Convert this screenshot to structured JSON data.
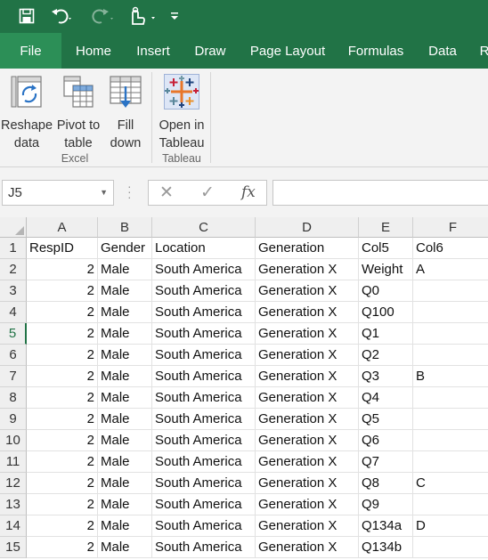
{
  "theme": {
    "brand": "#217346",
    "ribbon_bg": "#f3f3f3",
    "header_bg": "#efefef",
    "active_row_color": "#217346"
  },
  "quick_access": [
    {
      "name": "save-icon"
    },
    {
      "name": "undo-icon"
    },
    {
      "name": "redo-icon"
    },
    {
      "name": "touch-mode-icon"
    },
    {
      "name": "customize-quick-access-icon"
    }
  ],
  "tabs": [
    "File",
    "Home",
    "Insert",
    "Draw",
    "Page Layout",
    "Formulas",
    "Data",
    "R"
  ],
  "ribbon": {
    "buttons": [
      {
        "line1": "Reshape",
        "line2": "data",
        "icon": "reshape-data-icon"
      },
      {
        "line1": "Pivot to",
        "line2": "table",
        "icon": "pivot-table-icon"
      },
      {
        "line1": "Fill",
        "line2": "down",
        "icon": "fill-down-icon"
      },
      {
        "line1": "Open in",
        "line2": "Tableau",
        "icon": "tableau-icon"
      }
    ],
    "groups": [
      "Excel",
      "Tableau"
    ]
  },
  "formula_bar": {
    "name_box": "J5",
    "cancel_symbol": "✕",
    "enter_symbol": "✓",
    "fx_symbol": "fx",
    "formula": ""
  },
  "grid": {
    "active_row": "5",
    "columns": [
      "A",
      "B",
      "C",
      "D",
      "E",
      "F"
    ],
    "row_numbers": [
      "1",
      "2",
      "3",
      "4",
      "5",
      "6",
      "7",
      "8",
      "9",
      "10",
      "11",
      "12",
      "13",
      "14",
      "15"
    ],
    "rows": [
      [
        "RespID",
        "Gender",
        "Location",
        "Generation",
        "Col5",
        "Col6"
      ],
      [
        "2",
        "Male",
        "South America",
        "Generation X",
        "Weight",
        "A"
      ],
      [
        "2",
        "Male",
        "South America",
        "Generation X",
        "Q0",
        ""
      ],
      [
        "2",
        "Male",
        "South America",
        "Generation X",
        "Q100",
        ""
      ],
      [
        "2",
        "Male",
        "South America",
        "Generation X",
        "Q1",
        ""
      ],
      [
        "2",
        "Male",
        "South America",
        "Generation X",
        "Q2",
        ""
      ],
      [
        "2",
        "Male",
        "South America",
        "Generation X",
        "Q3",
        "B"
      ],
      [
        "2",
        "Male",
        "South America",
        "Generation X",
        "Q4",
        ""
      ],
      [
        "2",
        "Male",
        "South America",
        "Generation X",
        "Q5",
        ""
      ],
      [
        "2",
        "Male",
        "South America",
        "Generation X",
        "Q6",
        ""
      ],
      [
        "2",
        "Male",
        "South America",
        "Generation X",
        "Q7",
        ""
      ],
      [
        "2",
        "Male",
        "South America",
        "Generation X",
        "Q8",
        "C"
      ],
      [
        "2",
        "Male",
        "South America",
        "Generation X",
        "Q9",
        ""
      ],
      [
        "2",
        "Male",
        "South America",
        "Generation X",
        "Q134a",
        "D"
      ],
      [
        "2",
        "Male",
        "South America",
        "Generation X",
        "Q134b",
        ""
      ]
    ]
  }
}
